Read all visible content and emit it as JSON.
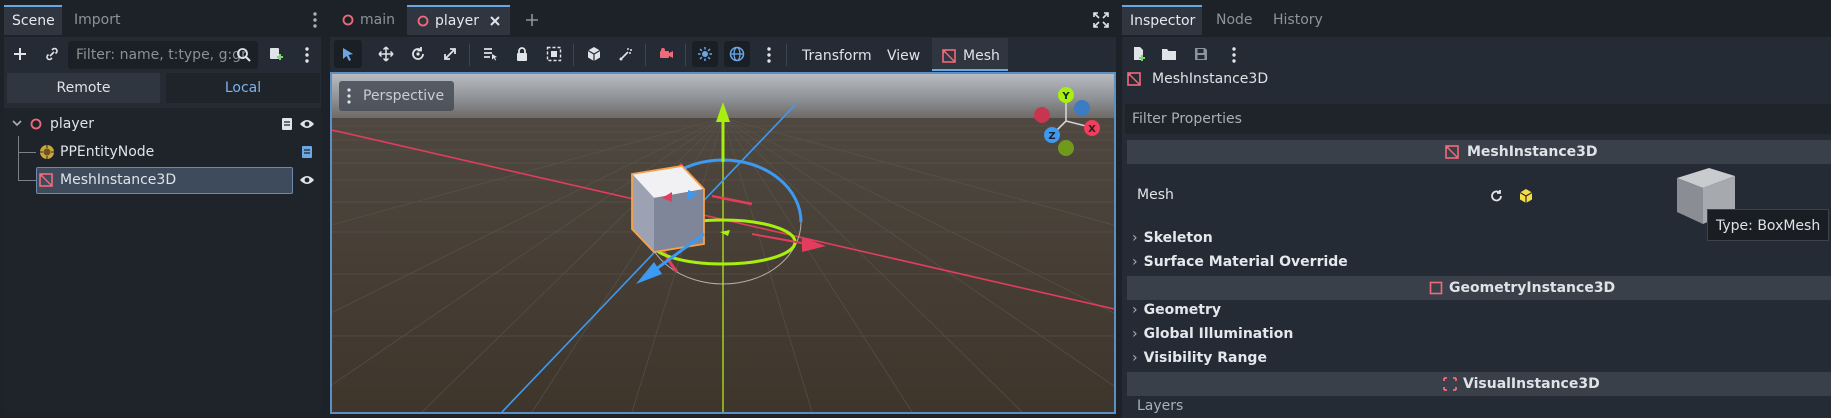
{
  "scene_dock": {
    "tabs": [
      "Scene",
      "Import"
    ],
    "filter_placeholder": "Filter: name, t:type, g:gr",
    "remote_label": "Remote",
    "local_label": "Local",
    "tree": [
      {
        "label": "player"
      },
      {
        "label": "PPEntityNode"
      },
      {
        "label": "MeshInstance3D"
      }
    ]
  },
  "editor_tabs": [
    "main",
    "player"
  ],
  "viewport": {
    "menus": [
      "Transform",
      "View",
      "Mesh"
    ],
    "perspective_label": "Perspective",
    "gizmo_axes": [
      "Y",
      "X",
      "Z"
    ]
  },
  "inspector": {
    "tabs": [
      "Inspector",
      "Node",
      "History"
    ],
    "node_name": "MeshInstance3D",
    "filter_label": "Filter Properties",
    "sections": [
      {
        "title": "MeshInstance3D",
        "icon_color": "#f06a7a"
      },
      {
        "title": "GeometryInstance3D",
        "icon_color": "#f06a7a"
      },
      {
        "title": "VisualInstance3D",
        "icon_color": "#f06a7a"
      }
    ],
    "mesh_label": "Mesh",
    "tooltip": "Type: BoxMesh",
    "mesh_subgroups": [
      "Skeleton",
      "Surface Material Override"
    ],
    "geometry_subgroups": [
      "Geometry",
      "Global Illumination",
      "Visibility Range"
    ],
    "layers_label": "Layers"
  },
  "colors": {
    "accent": "#6aa7e4",
    "node3d_red": "#f06a7a",
    "axis_x": "#f23d5c",
    "axis_y": "#a6ef0e",
    "axis_z": "#3d9af2"
  }
}
